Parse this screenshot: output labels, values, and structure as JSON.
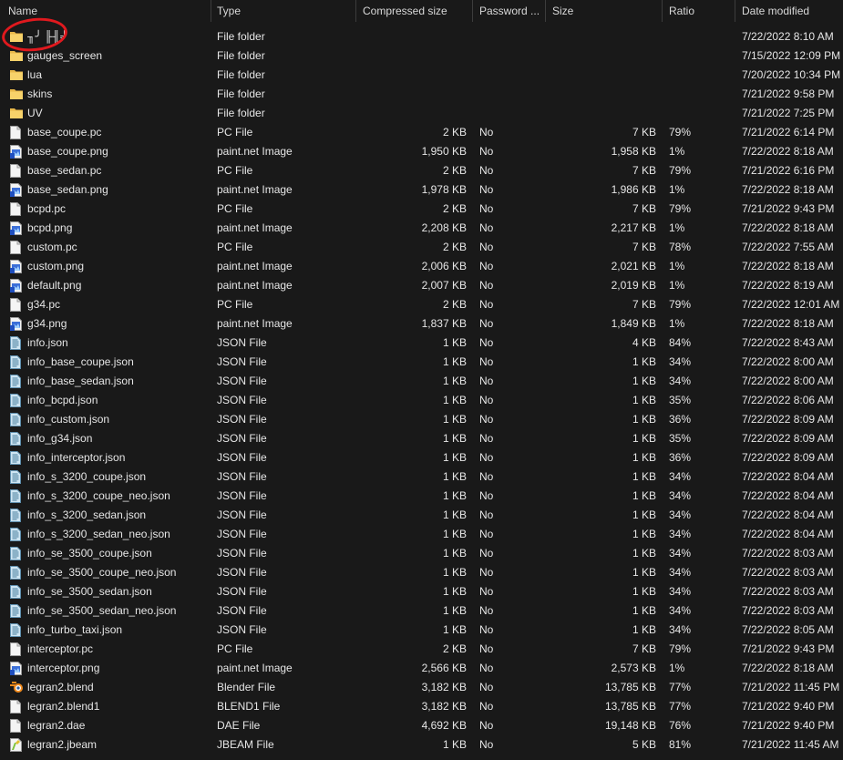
{
  "columns": {
    "name": "Name",
    "type": "Type",
    "compressed": "Compressed size",
    "password": "Password ...",
    "size": "Size",
    "ratio": "Ratio",
    "date": "Date modified"
  },
  "rows": [
    {
      "name": "╖╯ ╟╢╛",
      "type": "File folder",
      "compressed": "",
      "password": "",
      "size": "",
      "ratio": "",
      "date": "7/22/2022 8:10 AM",
      "icon": "folder-icon"
    },
    {
      "name": "gauges_screen",
      "type": "File folder",
      "compressed": "",
      "password": "",
      "size": "",
      "ratio": "",
      "date": "7/15/2022 12:09 PM",
      "icon": "folder-icon"
    },
    {
      "name": "lua",
      "type": "File folder",
      "compressed": "",
      "password": "",
      "size": "",
      "ratio": "",
      "date": "7/20/2022 10:34 PM",
      "icon": "folder-icon"
    },
    {
      "name": "skins",
      "type": "File folder",
      "compressed": "",
      "password": "",
      "size": "",
      "ratio": "",
      "date": "7/21/2022 9:58 PM",
      "icon": "folder-icon"
    },
    {
      "name": "UV",
      "type": "File folder",
      "compressed": "",
      "password": "",
      "size": "",
      "ratio": "",
      "date": "7/21/2022 7:25 PM",
      "icon": "folder-icon"
    },
    {
      "name": "base_coupe.pc",
      "type": "PC File",
      "compressed": "2 KB",
      "password": "No",
      "size": "7 KB",
      "ratio": "79%",
      "date": "7/21/2022 6:14 PM",
      "icon": "file-icon"
    },
    {
      "name": "base_coupe.png",
      "type": "paint.net Image",
      "compressed": "1,950 KB",
      "password": "No",
      "size": "1,958 KB",
      "ratio": "1%",
      "date": "7/22/2022 8:18 AM",
      "icon": "image-icon"
    },
    {
      "name": "base_sedan.pc",
      "type": "PC File",
      "compressed": "2 KB",
      "password": "No",
      "size": "7 KB",
      "ratio": "79%",
      "date": "7/21/2022 6:16 PM",
      "icon": "file-icon"
    },
    {
      "name": "base_sedan.png",
      "type": "paint.net Image",
      "compressed": "1,978 KB",
      "password": "No",
      "size": "1,986 KB",
      "ratio": "1%",
      "date": "7/22/2022 8:18 AM",
      "icon": "image-icon"
    },
    {
      "name": "bcpd.pc",
      "type": "PC File",
      "compressed": "2 KB",
      "password": "No",
      "size": "7 KB",
      "ratio": "79%",
      "date": "7/21/2022 9:43 PM",
      "icon": "file-icon"
    },
    {
      "name": "bcpd.png",
      "type": "paint.net Image",
      "compressed": "2,208 KB",
      "password": "No",
      "size": "2,217 KB",
      "ratio": "1%",
      "date": "7/22/2022 8:18 AM",
      "icon": "image-icon"
    },
    {
      "name": "custom.pc",
      "type": "PC File",
      "compressed": "2 KB",
      "password": "No",
      "size": "7 KB",
      "ratio": "78%",
      "date": "7/22/2022 7:55 AM",
      "icon": "file-icon"
    },
    {
      "name": "custom.png",
      "type": "paint.net Image",
      "compressed": "2,006 KB",
      "password": "No",
      "size": "2,021 KB",
      "ratio": "1%",
      "date": "7/22/2022 8:18 AM",
      "icon": "image-icon"
    },
    {
      "name": "default.png",
      "type": "paint.net Image",
      "compressed": "2,007 KB",
      "password": "No",
      "size": "2,019 KB",
      "ratio": "1%",
      "date": "7/22/2022 8:19 AM",
      "icon": "image-icon"
    },
    {
      "name": "g34.pc",
      "type": "PC File",
      "compressed": "2 KB",
      "password": "No",
      "size": "7 KB",
      "ratio": "79%",
      "date": "7/22/2022 12:01 AM",
      "icon": "file-icon"
    },
    {
      "name": "g34.png",
      "type": "paint.net Image",
      "compressed": "1,837 KB",
      "password": "No",
      "size": "1,849 KB",
      "ratio": "1%",
      "date": "7/22/2022 8:18 AM",
      "icon": "image-icon"
    },
    {
      "name": "info.json",
      "type": "JSON File",
      "compressed": "1 KB",
      "password": "No",
      "size": "4 KB",
      "ratio": "84%",
      "date": "7/22/2022 8:43 AM",
      "icon": "json-icon"
    },
    {
      "name": "info_base_coupe.json",
      "type": "JSON File",
      "compressed": "1 KB",
      "password": "No",
      "size": "1 KB",
      "ratio": "34%",
      "date": "7/22/2022 8:00 AM",
      "icon": "json-icon"
    },
    {
      "name": "info_base_sedan.json",
      "type": "JSON File",
      "compressed": "1 KB",
      "password": "No",
      "size": "1 KB",
      "ratio": "34%",
      "date": "7/22/2022 8:00 AM",
      "icon": "json-icon"
    },
    {
      "name": "info_bcpd.json",
      "type": "JSON File",
      "compressed": "1 KB",
      "password": "No",
      "size": "1 KB",
      "ratio": "35%",
      "date": "7/22/2022 8:06 AM",
      "icon": "json-icon"
    },
    {
      "name": "info_custom.json",
      "type": "JSON File",
      "compressed": "1 KB",
      "password": "No",
      "size": "1 KB",
      "ratio": "36%",
      "date": "7/22/2022 8:09 AM",
      "icon": "json-icon"
    },
    {
      "name": "info_g34.json",
      "type": "JSON File",
      "compressed": "1 KB",
      "password": "No",
      "size": "1 KB",
      "ratio": "35%",
      "date": "7/22/2022 8:09 AM",
      "icon": "json-icon"
    },
    {
      "name": "info_interceptor.json",
      "type": "JSON File",
      "compressed": "1 KB",
      "password": "No",
      "size": "1 KB",
      "ratio": "36%",
      "date": "7/22/2022 8:09 AM",
      "icon": "json-icon"
    },
    {
      "name": "info_s_3200_coupe.json",
      "type": "JSON File",
      "compressed": "1 KB",
      "password": "No",
      "size": "1 KB",
      "ratio": "34%",
      "date": "7/22/2022 8:04 AM",
      "icon": "json-icon"
    },
    {
      "name": "info_s_3200_coupe_neo.json",
      "type": "JSON File",
      "compressed": "1 KB",
      "password": "No",
      "size": "1 KB",
      "ratio": "34%",
      "date": "7/22/2022 8:04 AM",
      "icon": "json-icon"
    },
    {
      "name": "info_s_3200_sedan.json",
      "type": "JSON File",
      "compressed": "1 KB",
      "password": "No",
      "size": "1 KB",
      "ratio": "34%",
      "date": "7/22/2022 8:04 AM",
      "icon": "json-icon"
    },
    {
      "name": "info_s_3200_sedan_neo.json",
      "type": "JSON File",
      "compressed": "1 KB",
      "password": "No",
      "size": "1 KB",
      "ratio": "34%",
      "date": "7/22/2022 8:04 AM",
      "icon": "json-icon"
    },
    {
      "name": "info_se_3500_coupe.json",
      "type": "JSON File",
      "compressed": "1 KB",
      "password": "No",
      "size": "1 KB",
      "ratio": "34%",
      "date": "7/22/2022 8:03 AM",
      "icon": "json-icon"
    },
    {
      "name": "info_se_3500_coupe_neo.json",
      "type": "JSON File",
      "compressed": "1 KB",
      "password": "No",
      "size": "1 KB",
      "ratio": "34%",
      "date": "7/22/2022 8:03 AM",
      "icon": "json-icon"
    },
    {
      "name": "info_se_3500_sedan.json",
      "type": "JSON File",
      "compressed": "1 KB",
      "password": "No",
      "size": "1 KB",
      "ratio": "34%",
      "date": "7/22/2022 8:03 AM",
      "icon": "json-icon"
    },
    {
      "name": "info_se_3500_sedan_neo.json",
      "type": "JSON File",
      "compressed": "1 KB",
      "password": "No",
      "size": "1 KB",
      "ratio": "34%",
      "date": "7/22/2022 8:03 AM",
      "icon": "json-icon"
    },
    {
      "name": "info_turbo_taxi.json",
      "type": "JSON File",
      "compressed": "1 KB",
      "password": "No",
      "size": "1 KB",
      "ratio": "34%",
      "date": "7/22/2022 8:05 AM",
      "icon": "json-icon"
    },
    {
      "name": "interceptor.pc",
      "type": "PC File",
      "compressed": "2 KB",
      "password": "No",
      "size": "7 KB",
      "ratio": "79%",
      "date": "7/21/2022 9:43 PM",
      "icon": "file-icon"
    },
    {
      "name": "interceptor.png",
      "type": "paint.net Image",
      "compressed": "2,566 KB",
      "password": "No",
      "size": "2,573 KB",
      "ratio": "1%",
      "date": "7/22/2022 8:18 AM",
      "icon": "image-icon"
    },
    {
      "name": "legran2.blend",
      "type": "Blender File",
      "compressed": "3,182 KB",
      "password": "No",
      "size": "13,785 KB",
      "ratio": "77%",
      "date": "7/21/2022 11:45 PM",
      "icon": "blender-icon"
    },
    {
      "name": "legran2.blend1",
      "type": "BLEND1 File",
      "compressed": "3,182 KB",
      "password": "No",
      "size": "13,785 KB",
      "ratio": "77%",
      "date": "7/21/2022 9:40 PM",
      "icon": "file-icon"
    },
    {
      "name": "legran2.dae",
      "type": "DAE File",
      "compressed": "4,692 KB",
      "password": "No",
      "size": "19,148 KB",
      "ratio": "76%",
      "date": "7/21/2022 9:40 PM",
      "icon": "file-icon"
    },
    {
      "name": "legran2.jbeam",
      "type": "JBEAM File",
      "compressed": "1 KB",
      "password": "No",
      "size": "5 KB",
      "ratio": "81%",
      "date": "7/21/2022 11:45 AM",
      "icon": "jbeam-icon"
    }
  ],
  "colors": {
    "background": "#191919",
    "text": "#e6e6e6",
    "folder": "#f2c75c",
    "annotation_circle": "#e0191e"
  }
}
